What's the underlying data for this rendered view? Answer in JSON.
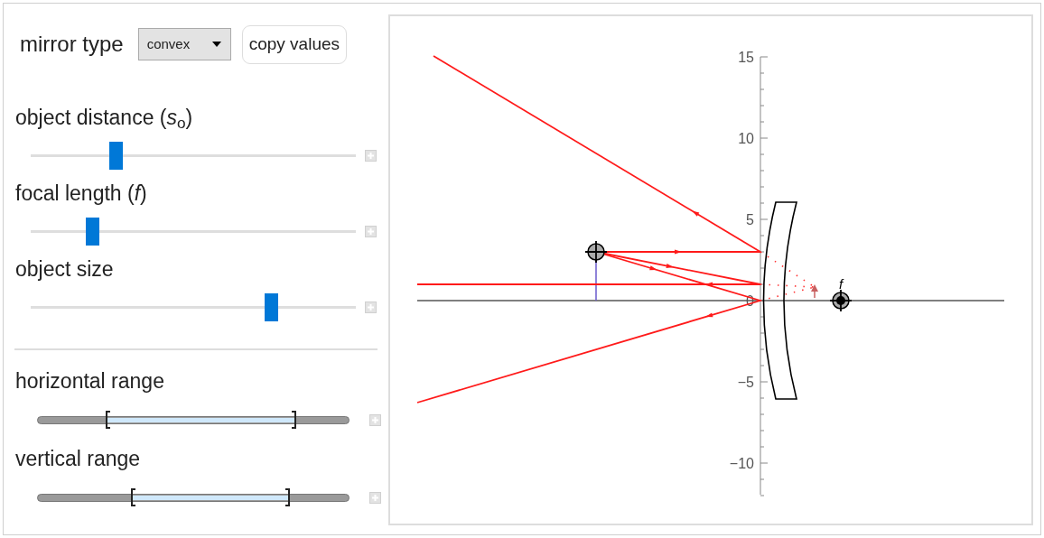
{
  "mirror_type": {
    "label": "mirror type",
    "value": "convex"
  },
  "copy_button": "copy values",
  "sliders": [
    {
      "label": "object distance (*s*$_{o}$)",
      "level": 0.26
    },
    {
      "label": "focal length (*f*)",
      "level": 0.19
    },
    {
      "label": "object size",
      "level": 0.74
    }
  ],
  "ranges": [
    {
      "label": "horizontal range",
      "thumbs": [
        {
          "level": 0.22
        },
        {
          "level": 0.83
        }
      ]
    },
    {
      "label": "vertical range",
      "thumbs": [
        {
          "level": 0.3
        },
        {
          "level": 0.81
        }
      ]
    }
  ],
  "plot": {
    "y_tick_labels": [
      "15",
      "10",
      "5",
      "0",
      "−5",
      "−10"
    ],
    "focal_label": "f"
  }
}
